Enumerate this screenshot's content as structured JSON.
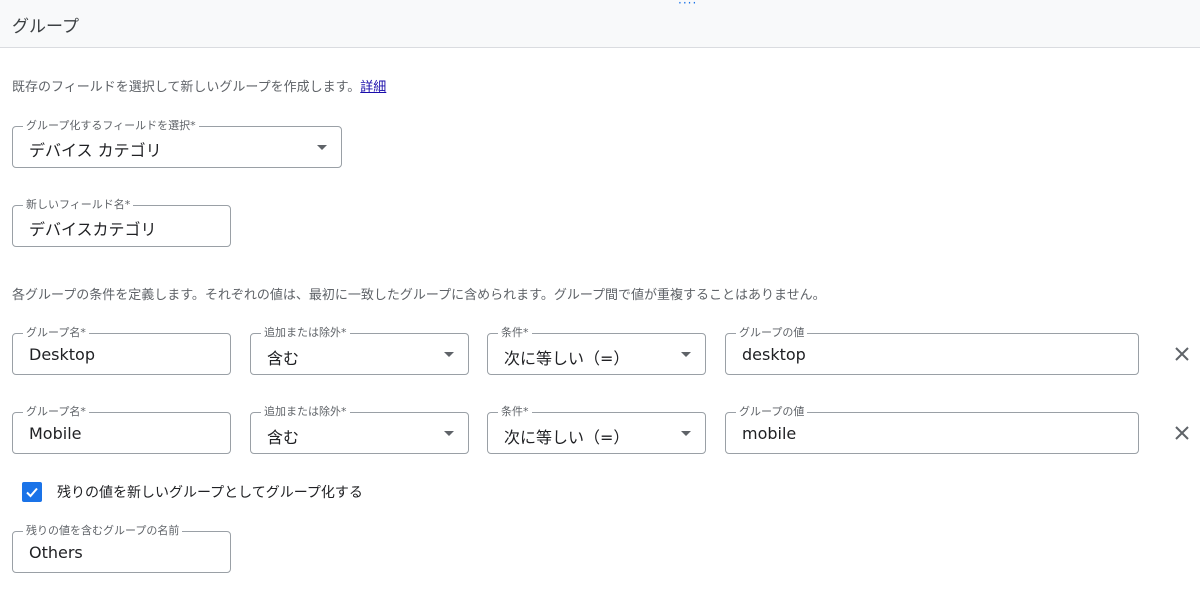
{
  "header": {
    "title": "グループ",
    "drag_handle": "····"
  },
  "intro": {
    "text": "既存のフィールドを選択して新しいグループを作成します。",
    "link": "詳細"
  },
  "group_field": {
    "label": "グループ化するフィールドを選択*",
    "value": "デバイス カテゴリ"
  },
  "new_field_name": {
    "label": "新しいフィールド名*",
    "value": "デバイスカテゴリ"
  },
  "conditions_desc": "各グループの条件を定義します。それぞれの値は、最初に一致したグループに含められます。グループ間で値が重複することはありません。",
  "groups": [
    {
      "name_label": "グループ名*",
      "name": "Desktop",
      "include_label": "追加または除外*",
      "include": "含む",
      "condition_label": "条件*",
      "condition": "次に等しい（=）",
      "value_label": "グループの値",
      "value": "desktop"
    },
    {
      "name_label": "グループ名*",
      "name": "Mobile",
      "include_label": "追加または除外*",
      "include": "含む",
      "condition_label": "条件*",
      "condition": "次に等しい（=）",
      "value_label": "グループの値",
      "value": "mobile"
    }
  ],
  "remaining": {
    "checkbox_label": "残りの値を新しいグループとしてグループ化する",
    "checked": true,
    "name_label": "残りの値を含むグループの名前",
    "name_value": "Others"
  },
  "colors": {
    "accent": "#1a73e8",
    "border": "#9aa0a6",
    "header_bg": "#f8f9fa"
  }
}
